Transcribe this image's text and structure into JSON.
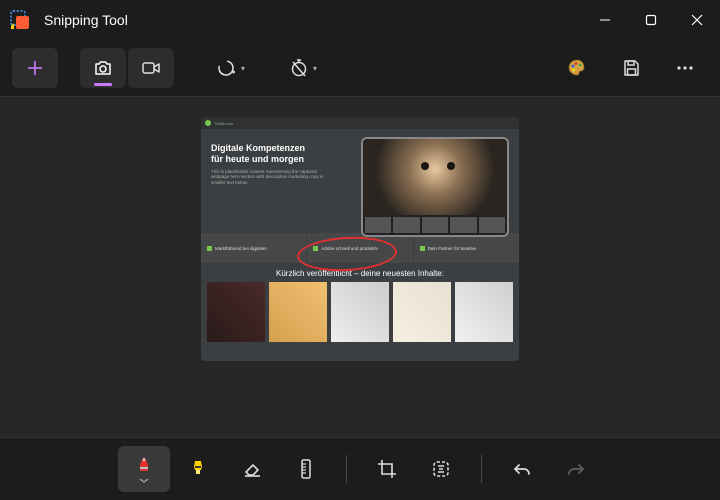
{
  "window": {
    "title": "Snipping Tool"
  },
  "toolbar": {
    "new": "New",
    "photo_mode": "Photo mode",
    "video_mode": "Video mode",
    "shape": "Snip shape",
    "delay": "Delay",
    "paint": "Edit in Paint",
    "save": "Save",
    "more": "More"
  },
  "bottom": {
    "pen": "Ballpoint pen",
    "highlighter": "Highlighter",
    "eraser": "Eraser",
    "ruler": "Ruler",
    "crop": "Crop",
    "text_actions": "Text actions",
    "undo": "Undo",
    "redo": "Redo"
  },
  "screenshot": {
    "heading_line1": "Digitale Kompetenzen",
    "heading_line2": "für heute und morgen",
    "subtext": "This is placeholder content representing the captured webpage hero section with descriptive marketing copy in smaller text below.",
    "info1": "Marktführend bei digitalen",
    "info2": "Adobe schnell und produktiv",
    "info3": "Dein Partner für kreative",
    "recent_title": "Kürzlich veröffentlicht – deine neuesten Inhalte:"
  },
  "colors": {
    "accent": "#c77dff",
    "pen": "#e03030",
    "highlighter": "#ffd400"
  }
}
